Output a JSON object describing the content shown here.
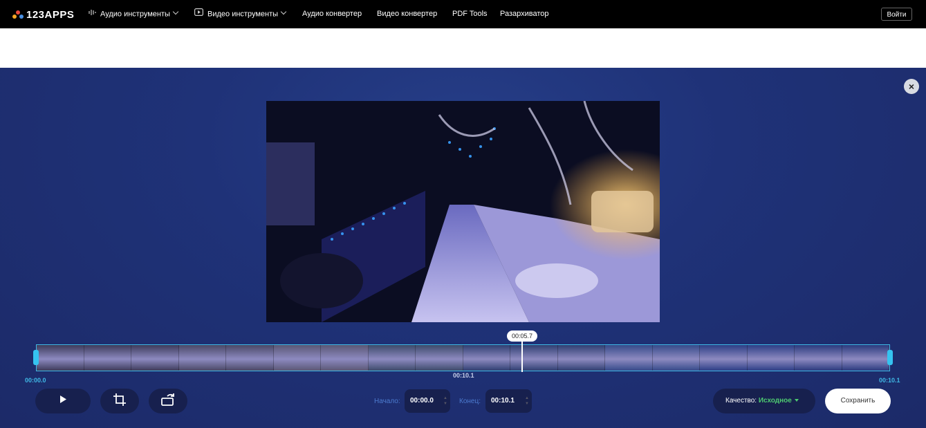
{
  "header": {
    "logo_text": "123APPS",
    "nav": [
      {
        "label": "Аудио инструменты",
        "icon": "waveform-icon",
        "dropdown": true
      },
      {
        "label": "Видео инструменты",
        "icon": "play-square-icon",
        "dropdown": true
      },
      {
        "label": "Аудио конвертер"
      },
      {
        "label": "Видео конвертер"
      },
      {
        "label": "PDF Tools"
      },
      {
        "label": "Разархиватор"
      }
    ],
    "login_label": "Войти"
  },
  "editor": {
    "close_icon": "×",
    "playhead_time": "00:05.7",
    "timeline_start": "00:00.0",
    "timeline_end": "00:10.1",
    "timeline_mid": "00:10.1",
    "start_label": "Начало:",
    "start_value": "00:00.0",
    "end_label": "Конец:",
    "end_value": "00:10.1",
    "quality_label": "Качество:",
    "quality_value": "Исходное",
    "save_label": "Сохранить",
    "playhead_fraction": 0.57
  },
  "colors": {
    "accent": "#35c3f0",
    "quality_green": "#4ecb71",
    "panel_bg": "#1f3278"
  }
}
